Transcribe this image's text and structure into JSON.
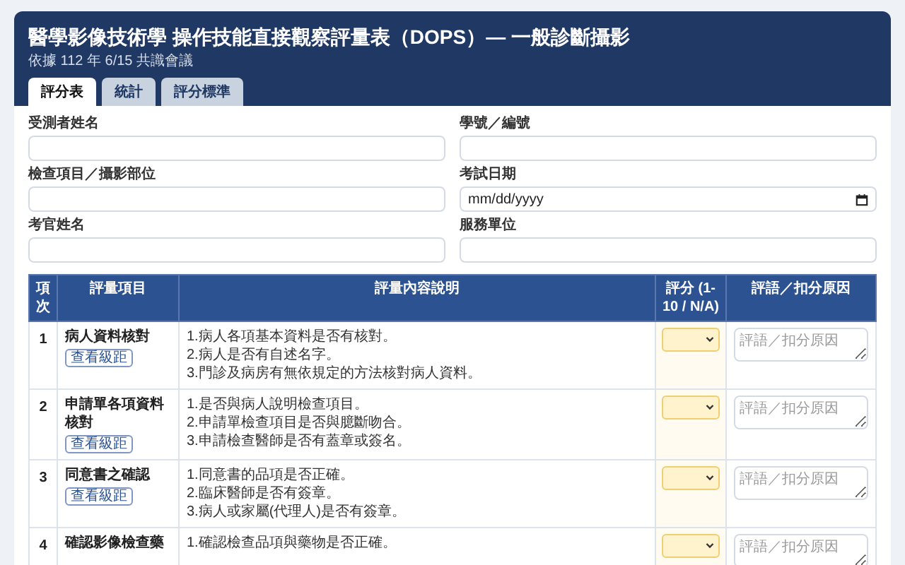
{
  "header": {
    "title": "醫學影像技術學 操作技能直接觀察評量表（DOPS）— 一般診斷攝影",
    "subtitle": "依據 112 年 6/15 共識會議"
  },
  "tabs": [
    {
      "label": "評分表",
      "selected": true
    },
    {
      "label": "統計",
      "selected": false
    },
    {
      "label": "評分標準",
      "selected": false
    }
  ],
  "fields": [
    {
      "label": "受測者姓名",
      "kind": "text"
    },
    {
      "label": "學號／編號",
      "kind": "text"
    },
    {
      "label": "檢查項目／攝影部位",
      "kind": "text"
    },
    {
      "label": "考試日期",
      "kind": "date",
      "placeholder": "mm/dd/yyyy"
    },
    {
      "label": "考官姓名",
      "kind": "text"
    },
    {
      "label": "服務單位",
      "kind": "text"
    }
  ],
  "table": {
    "columns": [
      "項次",
      "評量項目",
      "評量內容說明",
      "評分 (1-10 / N/A)",
      "評語／扣分原因"
    ],
    "rows": [
      {
        "no": "1",
        "item": "病人資料核對",
        "button": "查看級距",
        "details": [
          "1.病人各項基本資料是否有核對。",
          "2.病人是否有自述名字。",
          "3.門診及病房有無依規定的方法核對病人資料。"
        ],
        "comment_placeholder": "評語／扣分原因"
      },
      {
        "no": "2",
        "item": "申請單各項資料核對",
        "button": "查看級距",
        "details": [
          "1.是否與病人說明檢查項目。",
          "2.申請單檢查項目是否與臆斷吻合。",
          "3.申請檢查醫師是否有蓋章或簽名。"
        ],
        "comment_placeholder": "評語／扣分原因"
      },
      {
        "no": "3",
        "item": "同意書之確認",
        "button": "查看級距",
        "details": [
          "1.同意書的品項是否正確。",
          "2.臨床醫師是否有簽章。",
          "3.病人或家屬(代理人)是否有簽章。"
        ],
        "comment_placeholder": "評語／扣分原因"
      },
      {
        "no": "4",
        "item": "確認影像檢查藥",
        "details": [
          "1.確認檢查品項與藥物是否正確。"
        ],
        "comment_placeholder": "評語／扣分原因"
      }
    ]
  }
}
